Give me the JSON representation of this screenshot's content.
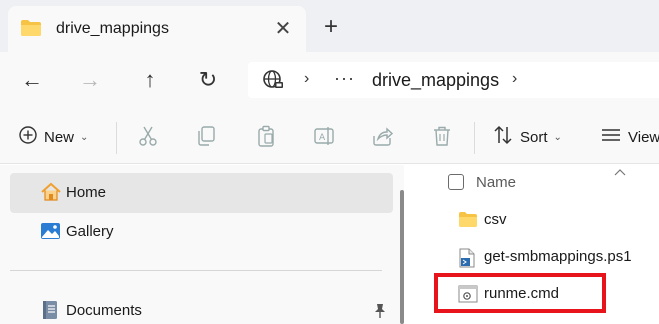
{
  "colors": {
    "accent_folder": "#f6c344",
    "highlight": "#e8141c",
    "selected_bg": "#e6e6e6",
    "home_icon": "#f0a030",
    "gallery_icon": "#2b7cd3"
  },
  "tab": {
    "title": "drive_mappings",
    "icon": "folder-icon",
    "close_glyph": "✕",
    "new_tab_glyph": "+"
  },
  "nav": {
    "back_glyph": "←",
    "forward_glyph": "→",
    "up_glyph": "↑",
    "refresh_glyph": "↻",
    "address": {
      "icon": "globe-icon",
      "separator": "›",
      "ellipsis": "···",
      "crumb": "drive_mappings"
    }
  },
  "commandbar": {
    "new_label": "New",
    "sort_label": "Sort",
    "view_label": "View",
    "chevron": "⌄",
    "icons": [
      "cut-icon",
      "copy-icon",
      "paste-icon",
      "rename-icon",
      "share-icon",
      "delete-icon"
    ]
  },
  "sidebar": {
    "items": [
      {
        "label": "Home",
        "icon": "home-icon",
        "selected": true
      },
      {
        "label": "Gallery",
        "icon": "gallery-icon",
        "selected": false
      },
      {
        "label": "Documents",
        "icon": "documents-icon",
        "selected": false
      }
    ]
  },
  "filelist": {
    "column_name": "Name",
    "files": [
      {
        "name": "csv",
        "icon": "folder-icon"
      },
      {
        "name": "get-smbmappings.ps1",
        "icon": "powershell-script-icon"
      },
      {
        "name": "runme.cmd",
        "icon": "cmd-script-icon"
      }
    ]
  }
}
